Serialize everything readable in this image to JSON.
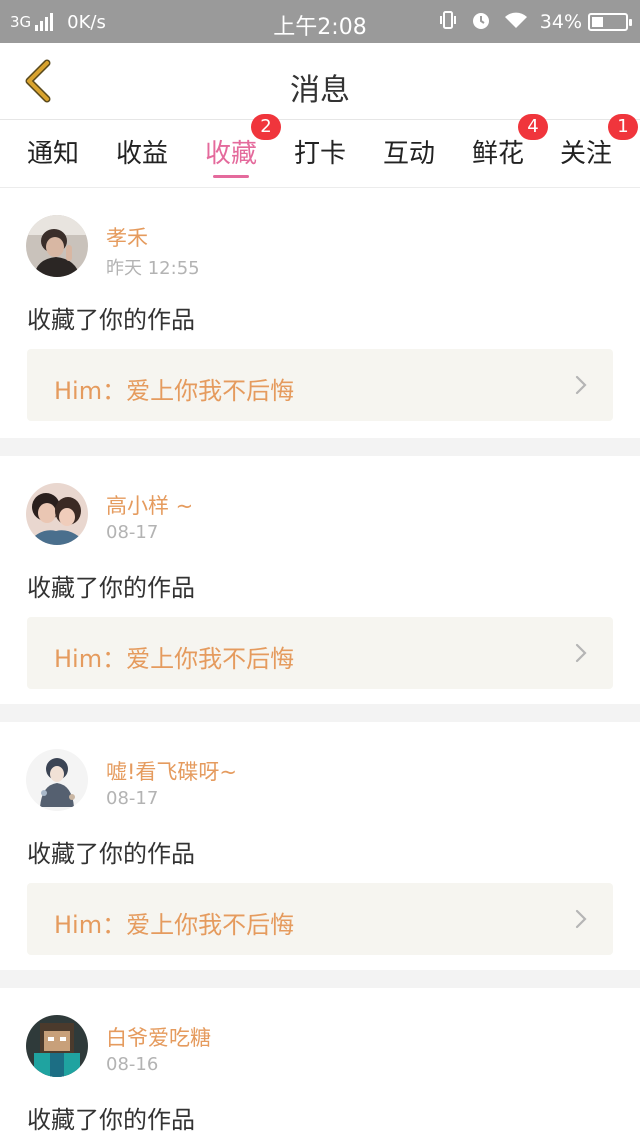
{
  "status_bar": {
    "network": "3G",
    "speed": "0K/s",
    "time": "上午2:08",
    "battery": "34%",
    "battery_level": 0.34,
    "icons": [
      "vibrate-icon",
      "alarm-icon",
      "wifi-icon",
      "battery-icon"
    ]
  },
  "header": {
    "title": "消息",
    "back_icon": "chevron-left-icon",
    "accent_color": "#d9a32e"
  },
  "tabs": [
    {
      "label": "通知",
      "badge": ""
    },
    {
      "label": "收益",
      "badge": ""
    },
    {
      "label": "收藏",
      "badge": "2",
      "active": true
    },
    {
      "label": "打卡",
      "badge": ""
    },
    {
      "label": "互动",
      "badge": ""
    },
    {
      "label": "鲜花",
      "badge": "4"
    },
    {
      "label": "关注",
      "badge": "1"
    }
  ],
  "colors": {
    "active_tab": "#e46a9c",
    "badge": "#f0353c",
    "username": "#e59b5e",
    "link_background": "#f6f5f0"
  },
  "feed": [
    {
      "username": "孝禾",
      "time": "昨天 12:55",
      "action": "收藏了你的作品",
      "work": "Him：爱上你我不后悔"
    },
    {
      "username": "高小样 ~",
      "time": "08-17",
      "action": "收藏了你的作品",
      "work": "Him：爱上你我不后悔"
    },
    {
      "username": "嘘!看飞碟呀~",
      "time": "08-17",
      "action": "收藏了你的作品",
      "work": "Him：爱上你我不后悔"
    },
    {
      "username": "白爷爱吃糖",
      "time": "08-16",
      "action": "收藏了你的作品",
      "work": ""
    }
  ]
}
